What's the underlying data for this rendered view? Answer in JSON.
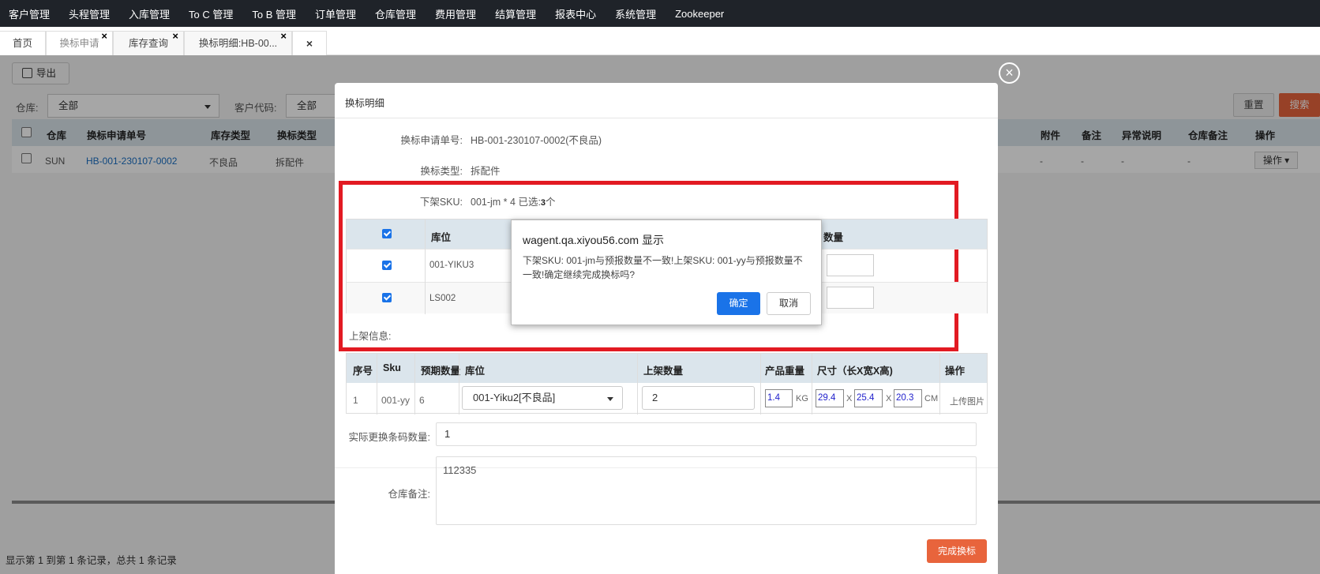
{
  "nav": {
    "items": [
      "客户管理",
      "头程管理",
      "入库管理",
      "To C 管理",
      "To B 管理",
      "订单管理",
      "仓库管理",
      "费用管理",
      "结算管理",
      "报表中心",
      "系统管理",
      "Zookeeper"
    ]
  },
  "tabs": {
    "home": "首页",
    "t1": "换标申请",
    "t2": "库存查询",
    "t3": "换标明细:HB-00...",
    "close_glyph": "×",
    "close_all_glyph": "×"
  },
  "page": {
    "export_label": "导出",
    "filter_warehouse_label": "仓库:",
    "filter_warehouse_value": "全部",
    "filter_customer_label": "客户代码:",
    "filter_customer_value": "全部",
    "reset_label": "重置",
    "search_label": "搜索",
    "table": {
      "headers": [
        "仓库",
        "换标申请单号",
        "库存类型",
        "换标类型",
        "附件",
        "备注",
        "异常说明",
        "仓库备注",
        "操作"
      ],
      "row": {
        "warehouse": "SUN",
        "app_no": "HB-001-230107-0002",
        "stock_type": "不良品",
        "relabel_type": "拆配件",
        "attachment": "-",
        "remark": "-",
        "exception": "-",
        "wh_remark": "-",
        "op_label": "操作 ▾"
      }
    },
    "footer": "显示第 1 到第 1 条记录，总共 1 条记录"
  },
  "modal": {
    "close_glyph": "×",
    "title": "换标明细",
    "app_no_label": "换标申请单号:",
    "app_no_value": "HB-001-230107-0002(不良品)",
    "relabel_type_label": "换标类型:",
    "relabel_type_value": "拆配件",
    "down_sku_label": "下架SKU:",
    "down_sku_value": "001-jm * 4 已选:",
    "down_sku_selected": "3",
    "down_sku_unit": "个",
    "sku_table": {
      "h_location": "库位",
      "h_qty": "数量",
      "rows": [
        {
          "location": "001-YIKU3",
          "checked": true
        },
        {
          "location": "LS002",
          "checked": true
        }
      ],
      "header_checked": true
    },
    "up_info_label": "上架信息:",
    "up_table": {
      "headers": [
        "序号",
        "Sku",
        "预期数量",
        "库位",
        "上架数量",
        "产品重量",
        "尺寸（长X宽X高)",
        "操作"
      ],
      "row": {
        "no": "1",
        "sku": "001-yy",
        "expected": "6",
        "location": "001-Yiku2[不良品]",
        "qty": "2",
        "weight": "1.4",
        "weight_unit": "KG",
        "len": "29.4",
        "wid": "25.4",
        "hgt": "20.3",
        "x1": "X",
        "x2": "X",
        "dim_unit": "CM",
        "op": "上传图片"
      }
    },
    "actual_count_label": "实际更换条码数量:",
    "actual_count_value": "1",
    "wh_remark_label": "仓库备注:",
    "wh_remark_value": "112335",
    "finish_label": "完成换标"
  },
  "alert": {
    "title": "wagent.qa.xiyou56.com 显示",
    "message": "下架SKU: 001-jm与预报数量不一致!上架SKU: 001-yy与预报数量不一致!确定继续完成换标吗?",
    "ok_label": "确定",
    "cancel_label": "取消"
  },
  "colors": {
    "nav_bg": "#1f2329",
    "accent_orange": "#e8643c",
    "primary_blue": "#1a73e8",
    "highlight_red": "#e21a22",
    "table_header": "#dbe5ec"
  }
}
